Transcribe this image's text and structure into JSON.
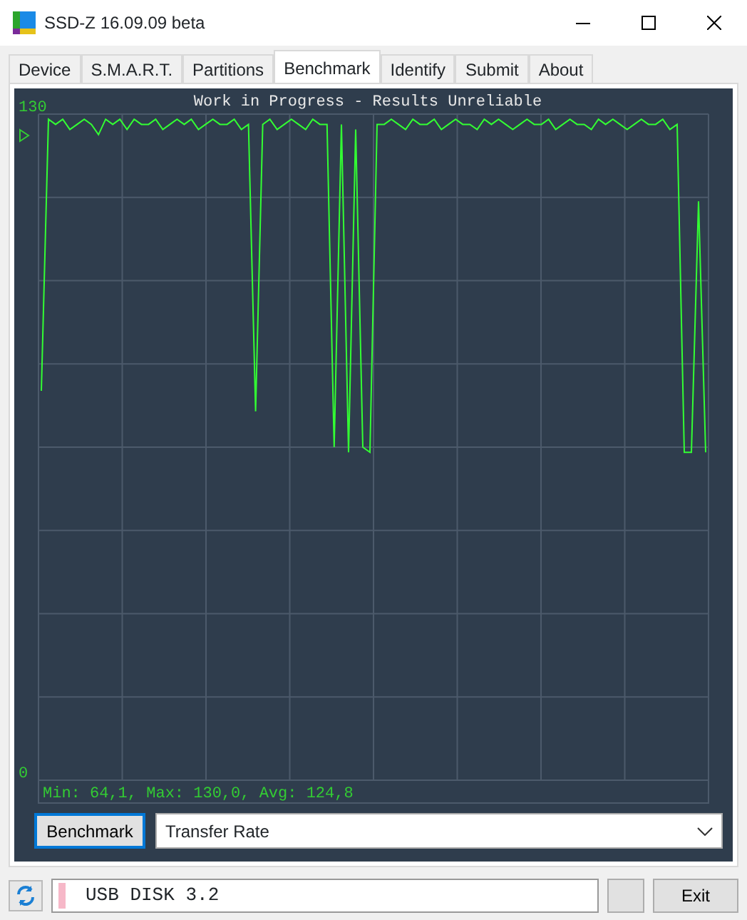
{
  "window": {
    "title": "SSD-Z 16.09.09 beta"
  },
  "tabs": [
    {
      "label": "Device",
      "selected": false
    },
    {
      "label": "S.M.A.R.T.",
      "selected": false
    },
    {
      "label": "Partitions",
      "selected": false
    },
    {
      "label": "Benchmark",
      "selected": true
    },
    {
      "label": "Identify",
      "selected": false
    },
    {
      "label": "Submit",
      "selected": false
    },
    {
      "label": "About",
      "selected": false
    }
  ],
  "benchmark": {
    "chart_data": {
      "type": "line",
      "title": "Work in Progress - Results Unreliable",
      "ylim": [
        0,
        130
      ],
      "yticks": [
        0,
        130
      ],
      "color": "#33ff33",
      "values": [
        76,
        129,
        128,
        129,
        127,
        128,
        129,
        128,
        126,
        129,
        128,
        129,
        127,
        129,
        128,
        128,
        129,
        127,
        128,
        129,
        128,
        129,
        127,
        128,
        129,
        128,
        128,
        129,
        127,
        128,
        72,
        128,
        129,
        127,
        128,
        129,
        128,
        127,
        129,
        128,
        128,
        65,
        128,
        64,
        127,
        65,
        64,
        128,
        128,
        129,
        128,
        127,
        129,
        128,
        128,
        129,
        127,
        128,
        129,
        128,
        128,
        127,
        129,
        128,
        129,
        128,
        127,
        128,
        129,
        128,
        128,
        129,
        127,
        128,
        129,
        128,
        128,
        127,
        129,
        128,
        129,
        128,
        127,
        128,
        129,
        128,
        128,
        129,
        127,
        128,
        64,
        64,
        113,
        64
      ]
    },
    "stats": "Min: 64,1, Max: 130,0, Avg: 124,8",
    "run_button": "Benchmark",
    "mode": {
      "value": "Transfer Rate"
    }
  },
  "status_bar": {
    "drive": "USB DISK 3.2",
    "exit_button": "Exit"
  }
}
